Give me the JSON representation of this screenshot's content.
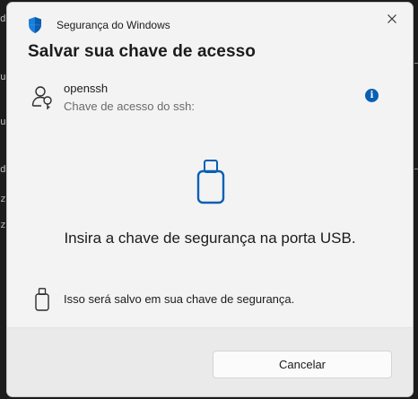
{
  "background": {
    "left_edge_chars": [
      "d",
      "u",
      "u",
      "d",
      "z",
      "z"
    ]
  },
  "dialog": {
    "app_title": "Segurança do Windows",
    "heading": "Salvar sua chave de acesso",
    "account": {
      "name": "openssh",
      "subtitle": "Chave de acesso do ssh:"
    },
    "instruction": "Insira a chave de segurança na porta USB.",
    "note": "Isso será salvo em sua chave de segurança.",
    "cancel_label": "Cancelar",
    "icons": {
      "app": "windows-security-shield-icon",
      "close": "close-icon",
      "account": "user-key-icon",
      "info": "info-icon",
      "usb_large": "usb-key-icon",
      "usb_small": "usb-key-icon"
    },
    "colors": {
      "accent": "#0a5fb4",
      "dialog_bg": "#f3f3f3",
      "footer_bg": "#eaeaea"
    }
  }
}
